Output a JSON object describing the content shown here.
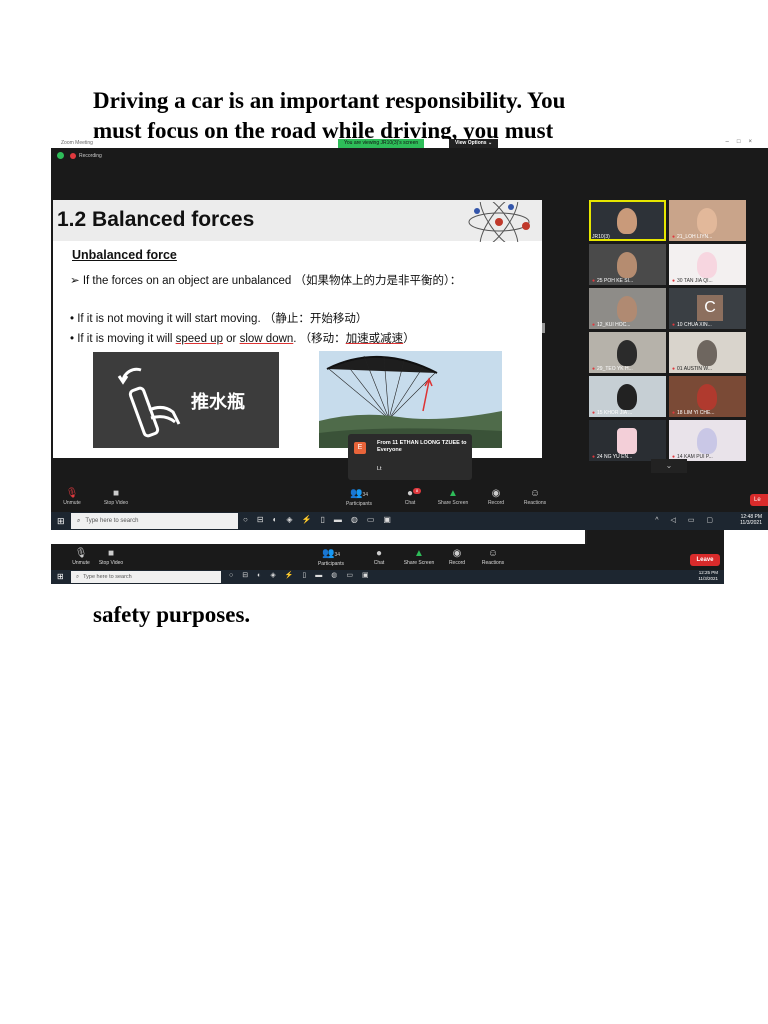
{
  "document": {
    "line1": "Driving a car is an important responsibility. You",
    "line2": "must focus on the road while driving, you must",
    "line_end": "safety purposes."
  },
  "zoom": {
    "window_title": "Zoom Meeting",
    "viewing_banner": "You are viewing JR10(3)'s screen",
    "view_options": "View Options",
    "recording": "Recording",
    "slide": {
      "title": "1.2 Balanced forces",
      "subheading": "Unbalanced force",
      "line1": "➢  If the forces on an object are unbalanced （如果物体上的力是非平衡的）：",
      "line2": "•    If it is not moving it will start moving. （静止：开始移动）",
      "line3_a": "•    If it is moving it will ",
      "line3_speed": "speed up",
      "line3_b": " or ",
      "line3_slow": "slow down",
      "line3_c": ". （移动：",
      "line3_accel": "加速或减速",
      "line3_d": "）",
      "image_label": "推水瓶"
    },
    "gallery": [
      {
        "name": "JR10(3)"
      },
      {
        "name": "21_LOH LIYN..."
      },
      {
        "name": "25 POH KE SI..."
      },
      {
        "name": "30 TAN JIA QI..."
      },
      {
        "name": "12_KUI HOC..."
      },
      {
        "name": "10 CHUA XIN..."
      },
      {
        "name": "29_TEO YK H..."
      },
      {
        "name": "01 AUSTIN W..."
      },
      {
        "name": "15 KHOR JIA ..."
      },
      {
        "name": "18 LIM YI CHE..."
      },
      {
        "name": "24 NG YU EN..."
      },
      {
        "name": "14 KAM PUI P..."
      }
    ],
    "gallery_tile_letter": "C",
    "chat_popup": {
      "avatar": "E",
      "from": "From 11 ETHAN LOONG TZUEE to Everyone",
      "message": "Lt"
    },
    "toolbar": {
      "unmute": "Unmute",
      "stop_video": "Stop Video",
      "participants": "Participants",
      "participants_count": "34",
      "chat": "Chat",
      "chat_badge": "8",
      "share_screen": "Share Screen",
      "record": "Record",
      "reactions": "Reactions",
      "leave": "Le"
    },
    "taskbar": {
      "search": "Type here to search",
      "time": "12:48 PM",
      "date": "11/3/2021"
    }
  },
  "zoom2": {
    "toolbar": {
      "unmute": "Unmute",
      "stop_video": "Stop Video",
      "participants": "Participants",
      "participants_count": "34",
      "chat": "Chat",
      "share_screen": "Share Screen",
      "record": "Record",
      "reactions": "Reactions",
      "leave": "Leave"
    },
    "taskbar": {
      "search": "Type here to search",
      "time": "12:25 PM",
      "date": "11/3/2021"
    }
  }
}
